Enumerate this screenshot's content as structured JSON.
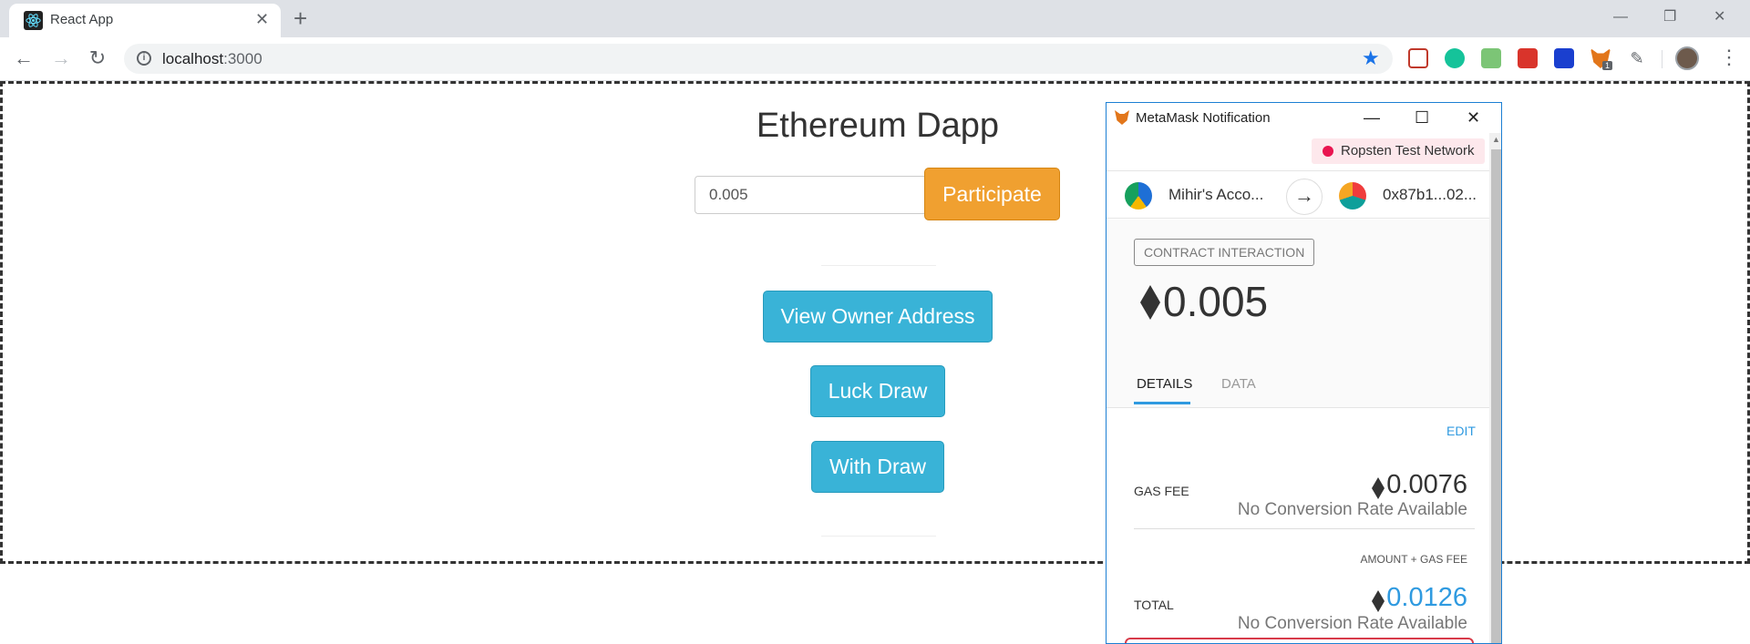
{
  "browser": {
    "tab_title": "React App",
    "tab_close": "✕",
    "new_tab": "+",
    "url_host": "localhost",
    "url_port": ":3000",
    "window_controls": {
      "minimize": "—",
      "restore": "❐",
      "close": "✕"
    },
    "extensions_badge": "1"
  },
  "app": {
    "title": "Ethereum Dapp",
    "amount_value": "0.005",
    "participate_label": "Participate",
    "view_owner_label": "View Owner Address",
    "luck_draw_label": "Luck Draw",
    "with_draw_label": "With Draw"
  },
  "metamask": {
    "window_title": "MetaMask Notification",
    "network": "Ropsten Test Network",
    "from_account": "Mihir's Acco...",
    "to_account": "0x87b1...02...",
    "tx_type": "CONTRACT INTERACTION",
    "amount": "0.005",
    "tabs": {
      "details": "DETAILS",
      "data": "DATA"
    },
    "edit_label": "EDIT",
    "gas_fee": {
      "label": "GAS FEE",
      "value": "0.0076",
      "conversion": "No Conversion Rate Available"
    },
    "total": {
      "top_label": "AMOUNT + GAS FEE",
      "label": "TOTAL",
      "value": "0.0126",
      "conversion": "No Conversion Rate Available"
    }
  },
  "colors": {
    "participate": "#f0a030",
    "action_button": "#39b3d7",
    "metamask_accent": "#2f9ae0",
    "network_dot": "#e91550"
  }
}
